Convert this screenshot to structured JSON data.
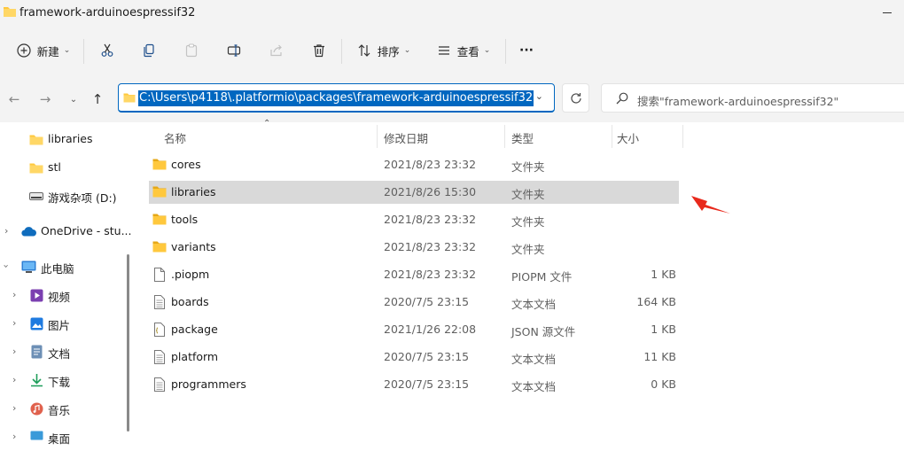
{
  "window": {
    "title": "framework-arduinoespressif32"
  },
  "toolbar": {
    "new_label": "新建",
    "sort_label": "排序",
    "view_label": "查看",
    "more_label": "···"
  },
  "address_bar": {
    "path": "C:\\Users\\p4118\\.platformio\\packages\\framework-arduinoespressif32"
  },
  "search": {
    "placeholder": "搜索\"framework-arduinoespressif32\""
  },
  "sidebar": {
    "items": [
      {
        "label": "libraries",
        "icon": "folder-icon"
      },
      {
        "label": "stl",
        "icon": "folder-icon"
      },
      {
        "label": "游戏杂项 (D:)",
        "icon": "drive-icon"
      },
      {
        "label": "OneDrive - stu...",
        "icon": "onedrive-icon"
      },
      {
        "label": "此电脑",
        "icon": "pc-icon"
      },
      {
        "label": "视频",
        "icon": "video-icon"
      },
      {
        "label": "图片",
        "icon": "picture-icon"
      },
      {
        "label": "文档",
        "icon": "document-icon"
      },
      {
        "label": "下载",
        "icon": "download-icon"
      },
      {
        "label": "音乐",
        "icon": "music-icon"
      },
      {
        "label": "桌面",
        "icon": "desktop-icon"
      }
    ]
  },
  "columns": {
    "name": "名称",
    "date": "修改日期",
    "type": "类型",
    "size": "大小"
  },
  "files": [
    {
      "name": "cores",
      "date": "2021/8/23 23:32",
      "type": "文件夹",
      "size": "",
      "icon": "folder-icon"
    },
    {
      "name": "libraries",
      "date": "2021/8/26 15:30",
      "type": "文件夹",
      "size": "",
      "icon": "folder-icon"
    },
    {
      "name": "tools",
      "date": "2021/8/23 23:32",
      "type": "文件夹",
      "size": "",
      "icon": "folder-icon"
    },
    {
      "name": "variants",
      "date": "2021/8/23 23:32",
      "type": "文件夹",
      "size": "",
      "icon": "folder-icon"
    },
    {
      "name": ".piopm",
      "date": "2021/8/23 23:32",
      "type": "PIOPM 文件",
      "size": "1 KB",
      "icon": "file-icon"
    },
    {
      "name": "boards",
      "date": "2020/7/5 23:15",
      "type": "文本文档",
      "size": "164 KB",
      "icon": "text-file-icon"
    },
    {
      "name": "package",
      "date": "2021/1/26 22:08",
      "type": "JSON 源文件",
      "size": "1 KB",
      "icon": "json-file-icon"
    },
    {
      "name": "platform",
      "date": "2020/7/5 23:15",
      "type": "文本文档",
      "size": "11 KB",
      "icon": "text-file-icon"
    },
    {
      "name": "programmers",
      "date": "2020/7/5 23:15",
      "type": "文本文档",
      "size": "0 KB",
      "icon": "text-file-icon"
    }
  ],
  "colors": {
    "accent": "#0067c0",
    "folder": "#ffc83d",
    "annotation_arrow": "#e8291c",
    "selected_row": "#d9d9d9"
  }
}
